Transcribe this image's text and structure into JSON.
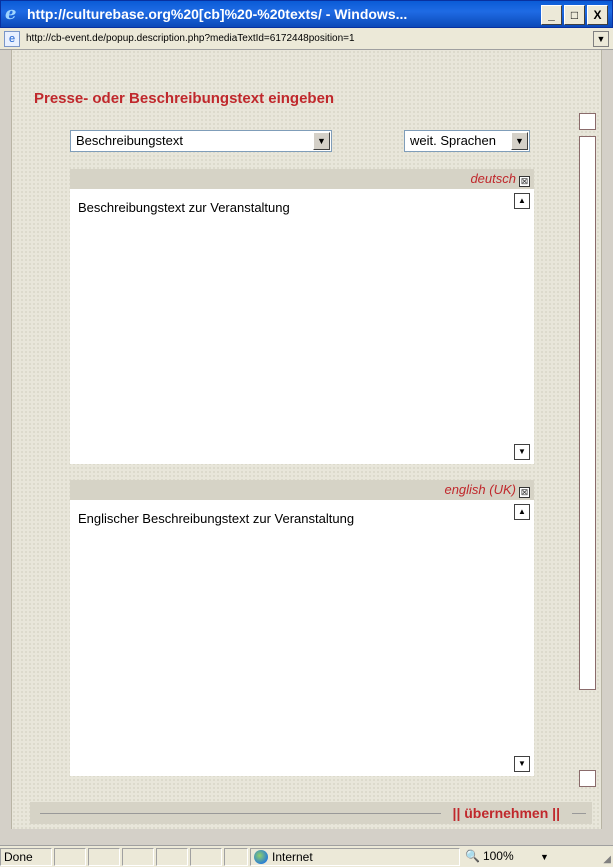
{
  "window": {
    "title": "http://culturebase.org%20[cb]%20-%20texts/ - Windows...",
    "minimize": "_",
    "maximize": "□",
    "close": "X"
  },
  "address": {
    "url": "http://cb-event.de/popup.description.php?mediaTextId=6172448position=1"
  },
  "form": {
    "heading": "Presse- oder Beschreibungstext eingeben",
    "type_select": "Beschreibungstext",
    "lang_select": "weit. Sprachen"
  },
  "sections": [
    {
      "lang": "deutsch",
      "text": "Beschreibungstext zur Veranstaltung"
    },
    {
      "lang": "english (UK)",
      "text": "Englischer Beschreibungstext zur Veranstaltung"
    }
  ],
  "footer": {
    "apply": "|| übernehmen ||"
  },
  "status": {
    "done": "Done",
    "zone": "Internet",
    "zoom": "100%"
  },
  "icons": {
    "close_box": "⊠",
    "scroll_up": "▲",
    "scroll_down": "▼"
  }
}
